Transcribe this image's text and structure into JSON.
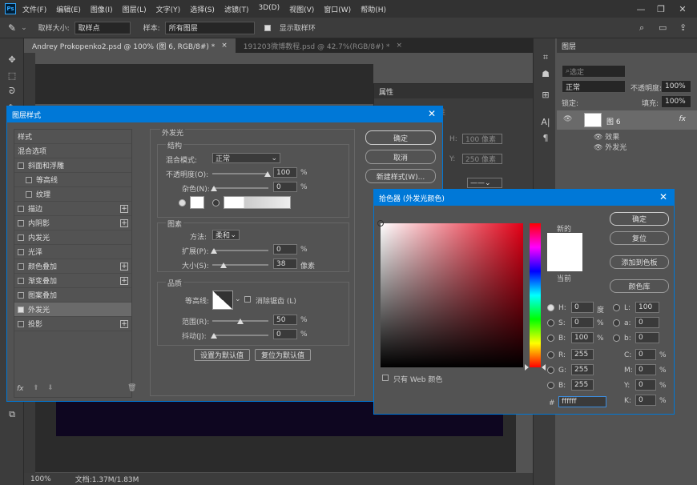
{
  "menu": [
    "文件(F)",
    "编辑(E)",
    "图像(I)",
    "图层(L)",
    "文字(Y)",
    "选择(S)",
    "滤镜(T)",
    "3D(D)",
    "视图(V)",
    "窗口(W)",
    "帮助(H)"
  ],
  "app_logo": "Ps",
  "options": {
    "sample_size_label": "取样大小:",
    "sample_size_value": "取样点",
    "sample_label": "样本:",
    "sample_value": "所有图层",
    "show_ring_label": "显示取样环"
  },
  "tabs": [
    "Andrey Prokopenko2.psd @ 100% (图 6, RGB/8#) *",
    "191203微博教程.psd @ 42.7%(RGB/8#) *"
  ],
  "status": {
    "zoom": "100%",
    "doc": "文档:1.37M/1.83M"
  },
  "properties": {
    "title": "属性",
    "width_placeholder": "100 像素",
    "y_label": "Y:",
    "y_value": "250 像素",
    "h_label": "H:",
    "title2": "性"
  },
  "layers_panel": {
    "title": "图层",
    "search": "选定",
    "blend": "正常",
    "opacity_label": "不透明度:",
    "opacity": "100%",
    "lock_label": "锁定:",
    "fill_label": "填充:",
    "fill": "100%",
    "layer_name": "图 6",
    "effects_label": "效果",
    "effect_item": "外发光",
    "fx": "fx"
  },
  "layer_style": {
    "title": "图层样式",
    "list": [
      {
        "label": "样式",
        "cb": false,
        "plus": false,
        "check": false
      },
      {
        "label": "混合选项",
        "cb": false,
        "plus": false,
        "check": false
      },
      {
        "label": "斜面和浮雕",
        "cb": true,
        "plus": false,
        "check": false
      },
      {
        "label": "等高线",
        "cb": true,
        "plus": false,
        "check": false,
        "indent": true
      },
      {
        "label": "纹理",
        "cb": true,
        "plus": false,
        "check": false,
        "indent": true
      },
      {
        "label": "描边",
        "cb": true,
        "plus": true,
        "check": false
      },
      {
        "label": "内阴影",
        "cb": true,
        "plus": true,
        "check": false
      },
      {
        "label": "内发光",
        "cb": true,
        "plus": false,
        "check": false
      },
      {
        "label": "光泽",
        "cb": true,
        "plus": false,
        "check": false
      },
      {
        "label": "颜色叠加",
        "cb": true,
        "plus": true,
        "check": false
      },
      {
        "label": "渐变叠加",
        "cb": true,
        "plus": true,
        "check": false
      },
      {
        "label": "图案叠加",
        "cb": true,
        "plus": false,
        "check": false
      },
      {
        "label": "外发光",
        "cb": true,
        "plus": false,
        "check": true,
        "active": true
      },
      {
        "label": "投影",
        "cb": true,
        "plus": true,
        "check": false
      }
    ],
    "section": "外发光",
    "structure": "结构",
    "blend_label": "混合模式:",
    "blend_value": "正常",
    "opacity_label": "不透明度(O):",
    "opacity": "100",
    "pct": "%",
    "noise_label": "杂色(N):",
    "noise": "0",
    "elements": "图素",
    "method_label": "方法:",
    "method_value": "柔和",
    "spread_label": "扩展(P):",
    "spread": "0",
    "size_label": "大小(S):",
    "size": "38",
    "px": "像素",
    "quality": "品质",
    "contour_label": "等高线:",
    "antialias_label": "消除锯齿 (L)",
    "range_label": "范围(R):",
    "range": "50",
    "jitter_label": "抖动(J):",
    "jitter": "0",
    "set_default": "设置为默认值",
    "reset_default": "复位为默认值",
    "ok": "确定",
    "cancel": "取消",
    "new_style": "新建样式(W)...",
    "fx": "fx"
  },
  "color_picker": {
    "title": "拾色器 (外发光颜色)",
    "ok": "确定",
    "reset": "复位",
    "add_swatch": "添加到色板",
    "libraries": "颜色库",
    "new_label": "新的",
    "current_label": "当前",
    "web_only": "只有 Web 颜色",
    "fields": {
      "H": "0",
      "S": "0",
      "B": "100",
      "R": "255",
      "G": "255",
      "Bb": "255",
      "L": "100",
      "a": "0",
      "b": "0",
      "C": "0",
      "M": "0",
      "Y": "0",
      "K": "0"
    },
    "hex": "ffffff"
  },
  "colors": {
    "accent": "#0078d7",
    "bg": "#535353",
    "panel": "#3c3c3c"
  }
}
